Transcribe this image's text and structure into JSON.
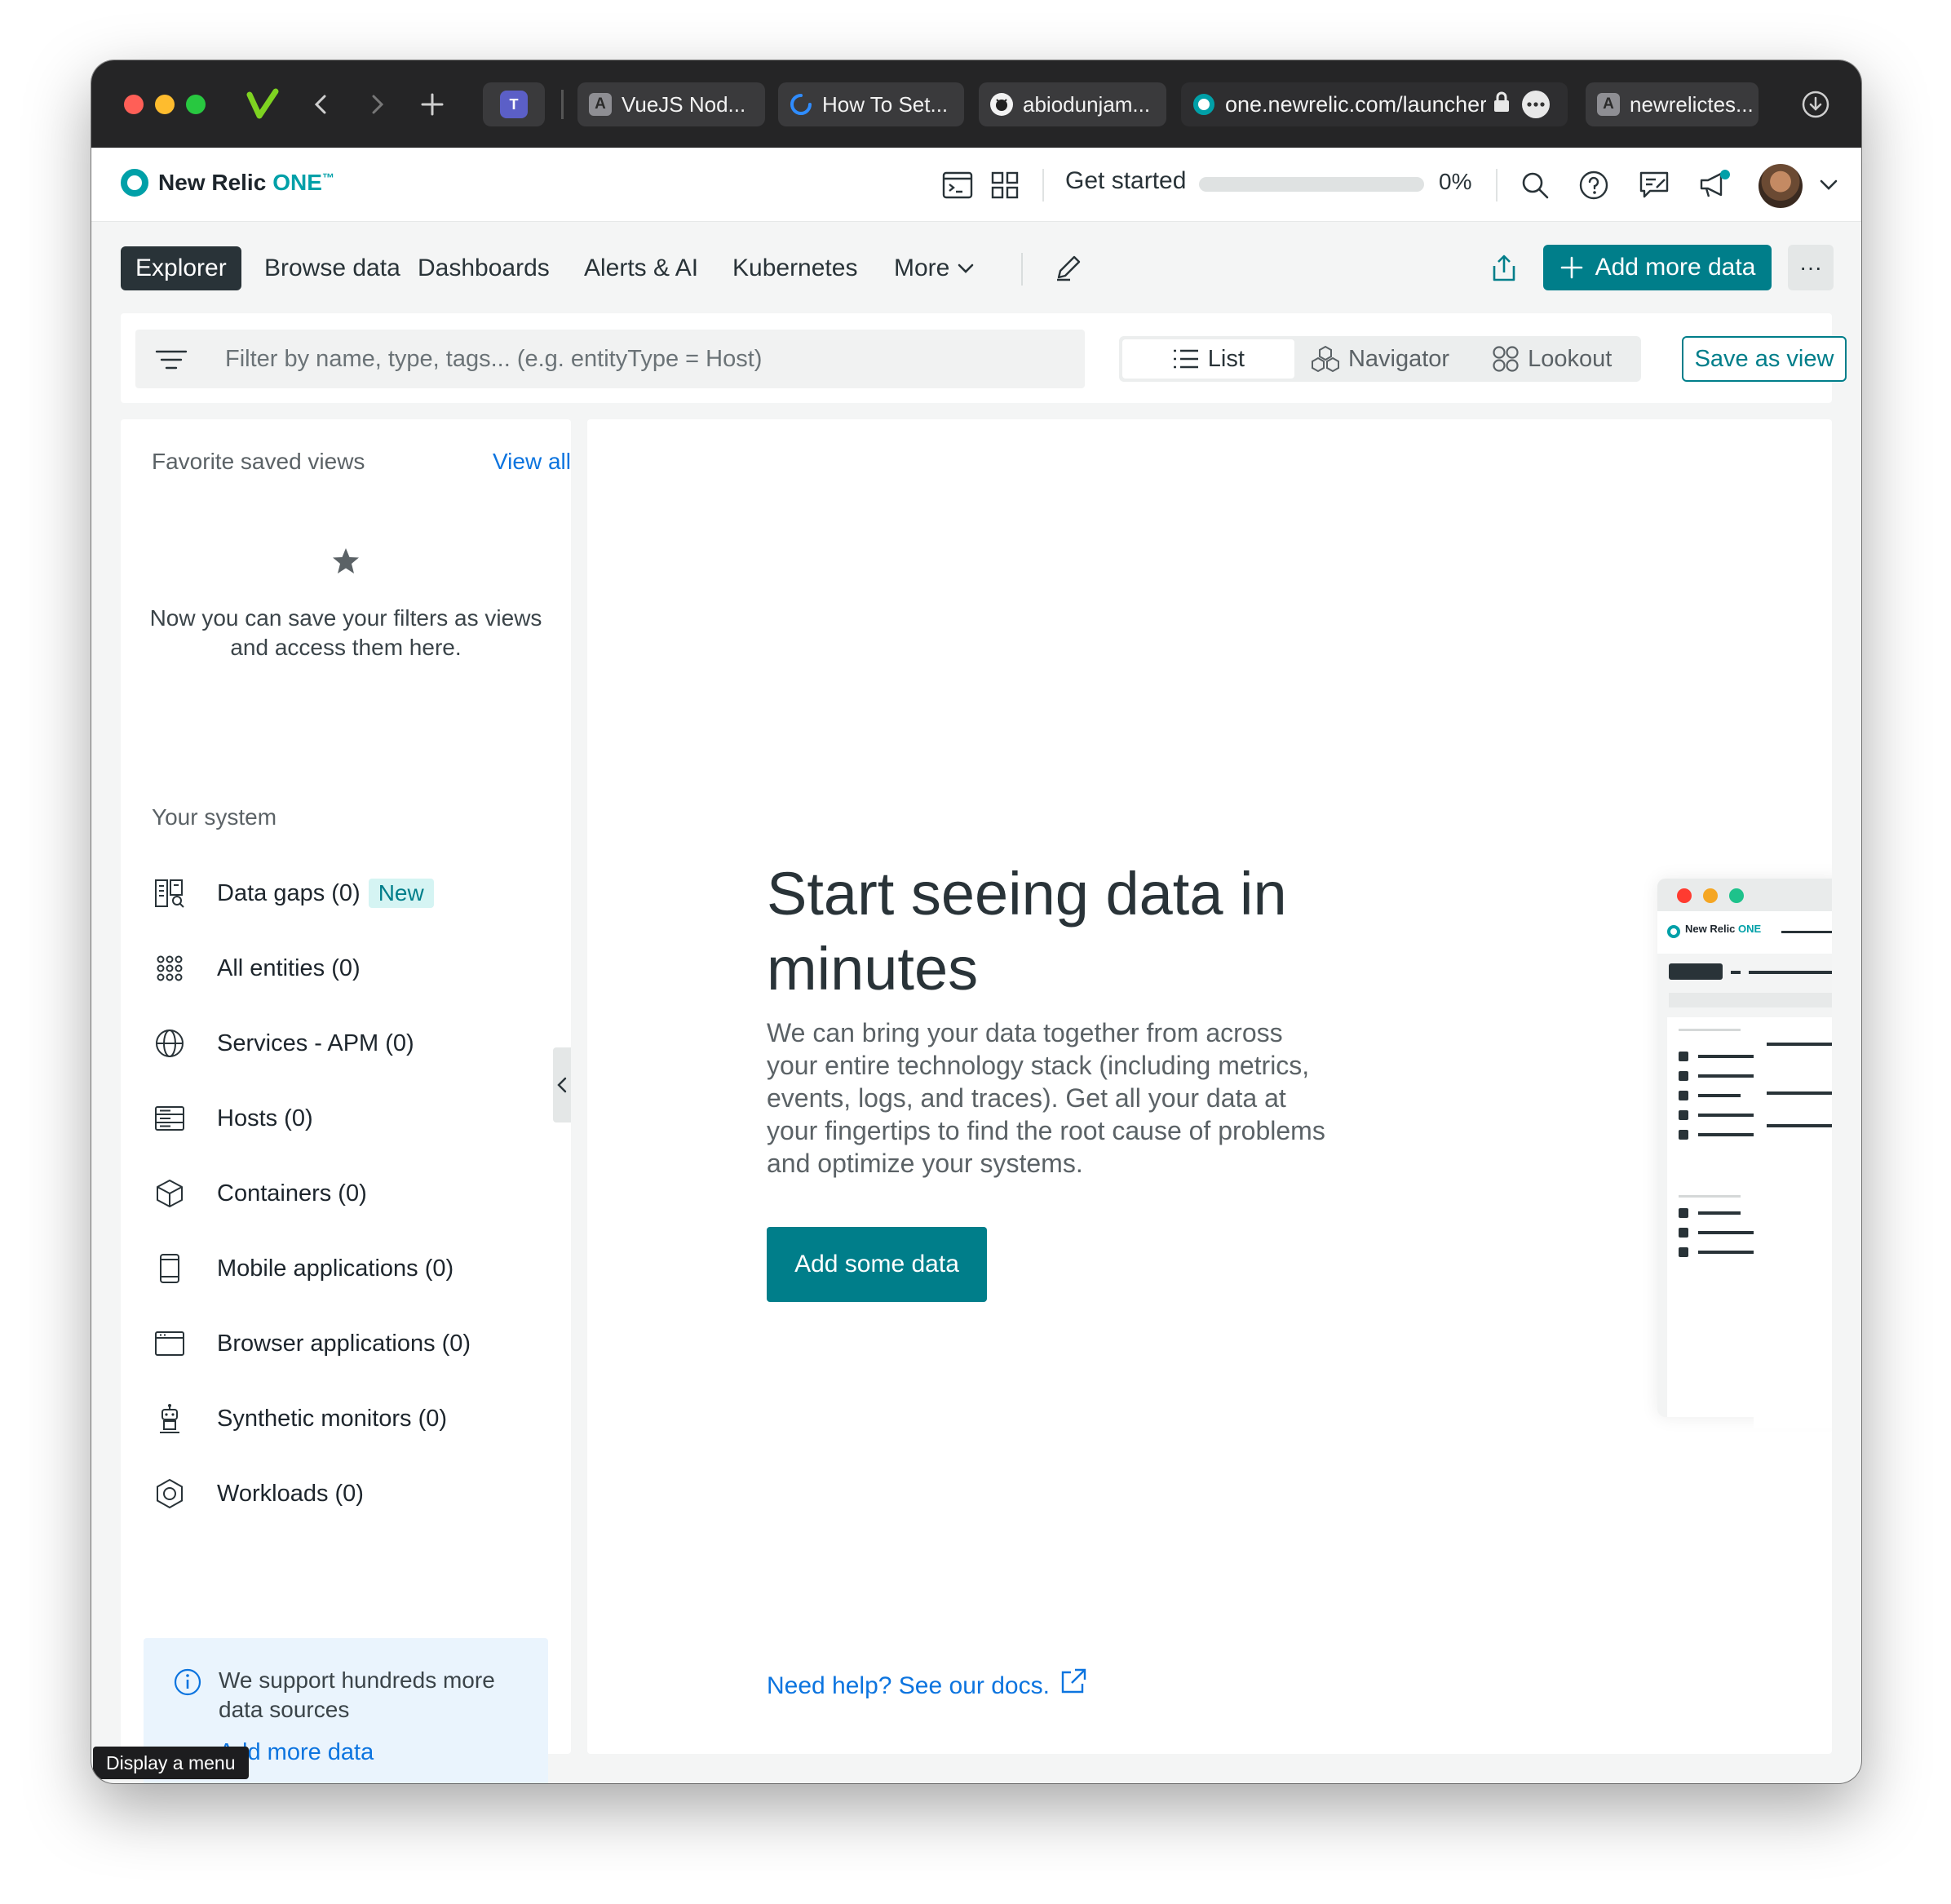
{
  "browser": {
    "tabs": [
      {
        "icon": "A",
        "label": "VueJS Nod..."
      },
      {
        "icon": "spinner",
        "label": "How To Set..."
      },
      {
        "icon": "github",
        "label": "abiodunjam..."
      },
      {
        "icon": "newrelic",
        "label": "one.newrelic.com/launcher"
      },
      {
        "icon": "A",
        "label": "newrelictes..."
      }
    ]
  },
  "header": {
    "logo_text": "New Relic",
    "logo_one": "ONE",
    "logo_tm": "™",
    "get_started": "Get started",
    "progress_percent": 0,
    "progress_label": "0%"
  },
  "nav": {
    "items": [
      "Explorer",
      "Browse data",
      "Dashboards",
      "Alerts & AI",
      "Kubernetes",
      "More"
    ],
    "add_more_data": "Add more data",
    "more_menu": "···"
  },
  "filter": {
    "placeholder": "Filter by name, type, tags... (e.g. entityType = Host)",
    "views": [
      "List",
      "Navigator",
      "Lookout"
    ],
    "save_as_view": "Save as view"
  },
  "sidebar": {
    "favorites_heading": "Favorite saved views",
    "view_all": "View all",
    "empty_text": "Now you can save your filters as views and access them here.",
    "system_heading": "Your system",
    "items": [
      {
        "label": "Data gaps (0)",
        "badge": "New",
        "icon": "data-gaps-icon"
      },
      {
        "label": "All entities (0)",
        "icon": "grid-dots-icon"
      },
      {
        "label": "Services - APM (0)",
        "icon": "globe-icon"
      },
      {
        "label": "Hosts (0)",
        "icon": "server-icon"
      },
      {
        "label": "Containers (0)",
        "icon": "cube-icon"
      },
      {
        "label": "Mobile applications (0)",
        "icon": "mobile-icon"
      },
      {
        "label": "Browser applications (0)",
        "icon": "browser-window-icon"
      },
      {
        "label": "Synthetic monitors (0)",
        "icon": "robot-icon"
      },
      {
        "label": "Workloads (0)",
        "icon": "hexagon-icon"
      }
    ],
    "info_text": "We support hundreds more data sources",
    "info_link": "Add more data"
  },
  "main": {
    "title": "Start seeing data in minutes",
    "body": "We can bring your data together from across your entire technology stack (including metrics, events, logs, and traces). Get all your data at your fingertips to find the root cause of problems and optimize your systems.",
    "button": "Add some data",
    "help_link": "Need help? See our docs.",
    "mock_logo": "New Relic",
    "mock_one": "ONE"
  },
  "tooltip": "Display a menu",
  "colors": {
    "teal": "#007e8a",
    "logo_teal": "#00a0a8",
    "link_blue": "#0c74df",
    "dark": "#293338"
  }
}
